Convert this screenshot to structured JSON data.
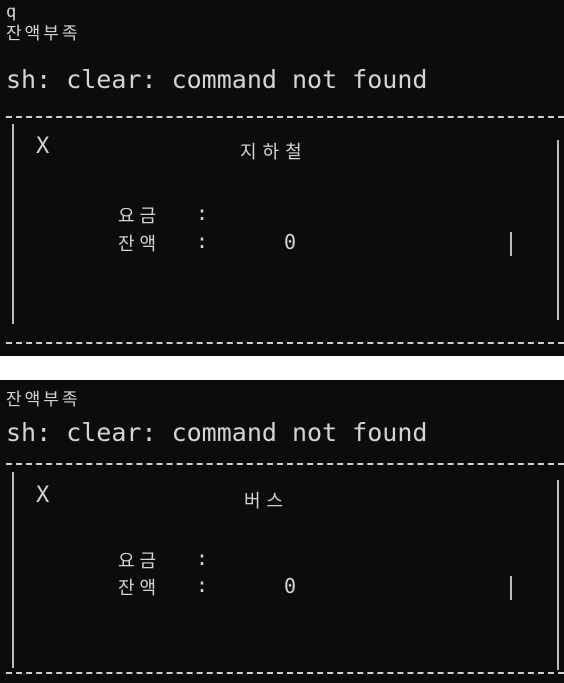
{
  "screens": [
    {
      "output_lines": [
        "q",
        "잔액부족",
        "sh: clear: command not found"
      ],
      "panel": {
        "close_label": "X",
        "title": "지하철",
        "fare_label": "요금",
        "balance_label": "잔액",
        "colon": ":",
        "balance_value": "0"
      }
    },
    {
      "output_lines": [
        "잔액부족",
        "sh: clear: command not found"
      ],
      "panel": {
        "close_label": "X",
        "title": "버스",
        "fare_label": "요금",
        "balance_label": "잔액",
        "colon": ":",
        "balance_value": "0"
      }
    }
  ],
  "colors": {
    "terminal_bg": "#0c0c0c",
    "terminal_fg": "#d4d4d4",
    "page_bg": "#ffffff"
  }
}
